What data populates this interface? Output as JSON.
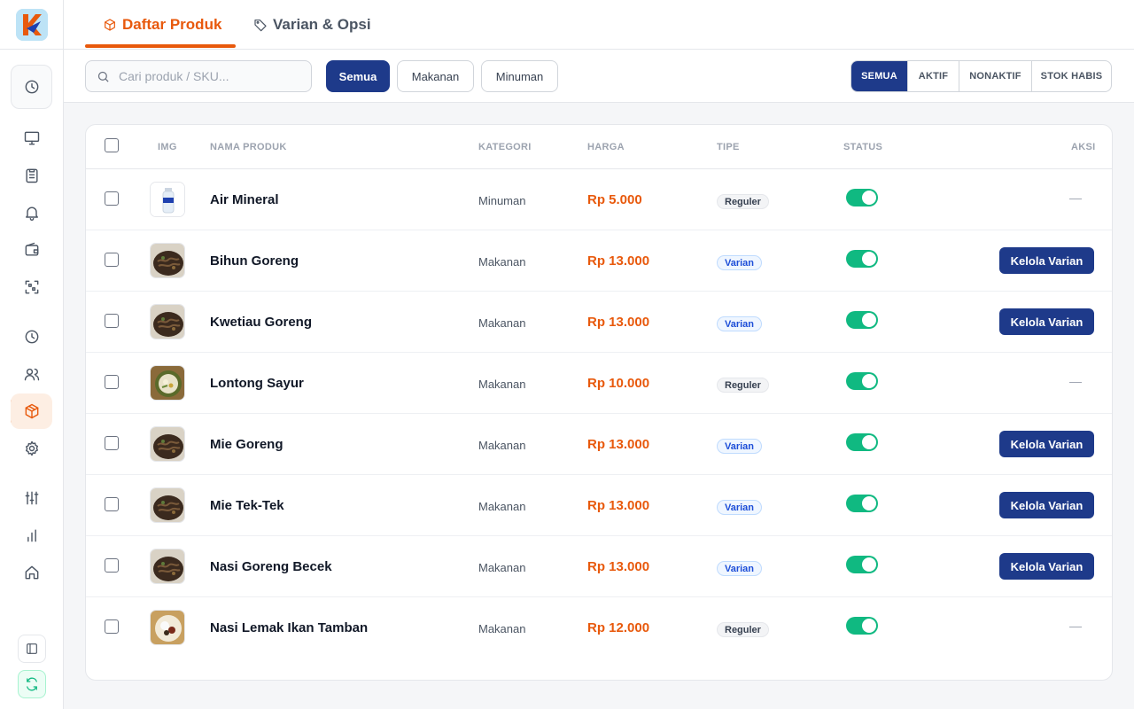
{
  "tabs": [
    {
      "label": "Daftar Produk",
      "icon": "box-icon",
      "active": true
    },
    {
      "label": "Varian & Opsi",
      "icon": "tag-icon",
      "active": false
    }
  ],
  "search": {
    "placeholder": "Cari produk / SKU...",
    "value": ""
  },
  "category_filters": [
    {
      "label": "Semua",
      "active": true
    },
    {
      "label": "Makanan",
      "active": false
    },
    {
      "label": "Minuman",
      "active": false
    }
  ],
  "status_filters": [
    {
      "label": "SEMUA",
      "active": true
    },
    {
      "label": "AKTIF",
      "active": false
    },
    {
      "label": "NONAKTIF",
      "active": false
    },
    {
      "label": "STOK HABIS",
      "active": false
    }
  ],
  "table": {
    "headers": {
      "img": "IMG",
      "name": "NAMA PRODUK",
      "category": "KATEGORI",
      "price": "HARGA",
      "type": "TIPE",
      "status": "STATUS",
      "action": "AKSI"
    },
    "rows": [
      {
        "name": "Air Mineral",
        "category": "Minuman",
        "price": "Rp 5.000",
        "type": "Reguler",
        "active": true,
        "action": "—",
        "image": "bottle"
      },
      {
        "name": "Bihun Goreng",
        "category": "Makanan",
        "price": "Rp 13.000",
        "type": "Varian",
        "active": true,
        "action": "Kelola Varian",
        "image": "noodle"
      },
      {
        "name": "Kwetiau Goreng",
        "category": "Makanan",
        "price": "Rp 13.000",
        "type": "Varian",
        "active": true,
        "action": "Kelola Varian",
        "image": "noodle"
      },
      {
        "name": "Lontong Sayur",
        "category": "Makanan",
        "price": "Rp 10.000",
        "type": "Reguler",
        "active": true,
        "action": "—",
        "image": "bowl"
      },
      {
        "name": "Mie Goreng",
        "category": "Makanan",
        "price": "Rp 13.000",
        "type": "Varian",
        "active": true,
        "action": "Kelola Varian",
        "image": "noodle"
      },
      {
        "name": "Mie Tek-Tek",
        "category": "Makanan",
        "price": "Rp 13.000",
        "type": "Varian",
        "active": true,
        "action": "Kelola Varian",
        "image": "noodle"
      },
      {
        "name": "Nasi Goreng Becek",
        "category": "Makanan",
        "price": "Rp 13.000",
        "type": "Varian",
        "active": true,
        "action": "Kelola Varian",
        "image": "noodle"
      },
      {
        "name": "Nasi Lemak Ikan Tamban",
        "category": "Makanan",
        "price": "Rp 12.000",
        "type": "Reguler",
        "active": true,
        "action": "—",
        "image": "plate"
      }
    ]
  },
  "sidebar": {
    "icons": [
      "clock-icon",
      "monitor-icon",
      "clipboard-icon",
      "bell-icon",
      "wallet-icon",
      "qr-scan-icon",
      "history-icon",
      "users-icon",
      "package-icon",
      "settings-icon",
      "sliders-icon",
      "bar-chart-icon",
      "home-icon",
      "panel-toggle-icon",
      "sync-icon"
    ],
    "active": "package-icon"
  },
  "colors": {
    "accent": "#e8590c",
    "primary": "#1e3a8a",
    "toggle_on": "#10b981"
  }
}
